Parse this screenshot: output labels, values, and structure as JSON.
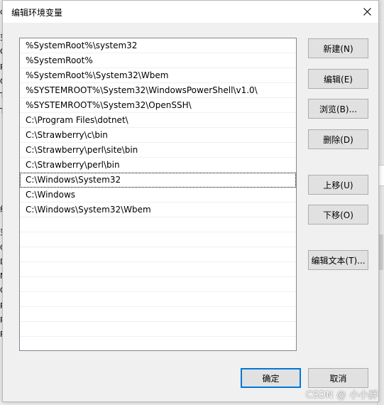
{
  "dialog": {
    "title": "编辑环境变量"
  },
  "list": {
    "items": [
      "%SystemRoot%\\system32",
      "%SystemRoot%",
      "%SystemRoot%\\System32\\Wbem",
      "%SYSTEMROOT%\\System32\\WindowsPowerShell\\v1.0\\",
      "%SYSTEMROOT%\\System32\\OpenSSH\\",
      "C:\\Program Files\\dotnet\\",
      "C:\\Strawberry\\c\\bin",
      "C:\\Strawberry\\perl\\site\\bin",
      "C:\\Strawberry\\perl\\bin",
      "C:\\Windows\\System32",
      "C:\\Windows",
      "C:\\Windows\\System32\\Wbem"
    ],
    "selected_index": 9
  },
  "buttons": {
    "new": "新建(N)",
    "edit": "编辑(E)",
    "browse": "浏览(B)...",
    "delete": "删除(D)",
    "move_up": "上移(U)",
    "move_down": "下移(O)",
    "edit_text": "编辑文本(T)...",
    "ok": "确定",
    "cancel": "取消"
  },
  "background": {
    "fragments": [
      "o",
      "变",
      "O",
      "Pa",
      "Q",
      "TE",
      "TM",
      "统",
      "变",
      "Co",
      "Dr",
      "N",
      "O",
      "Pa",
      "PA",
      "PF"
    ]
  },
  "watermark": "CSDN @ 小小胖",
  "colors": {
    "accent": "#0078d7",
    "button_face": "#e1e1e1",
    "window_bg": "#f0f0f0"
  }
}
